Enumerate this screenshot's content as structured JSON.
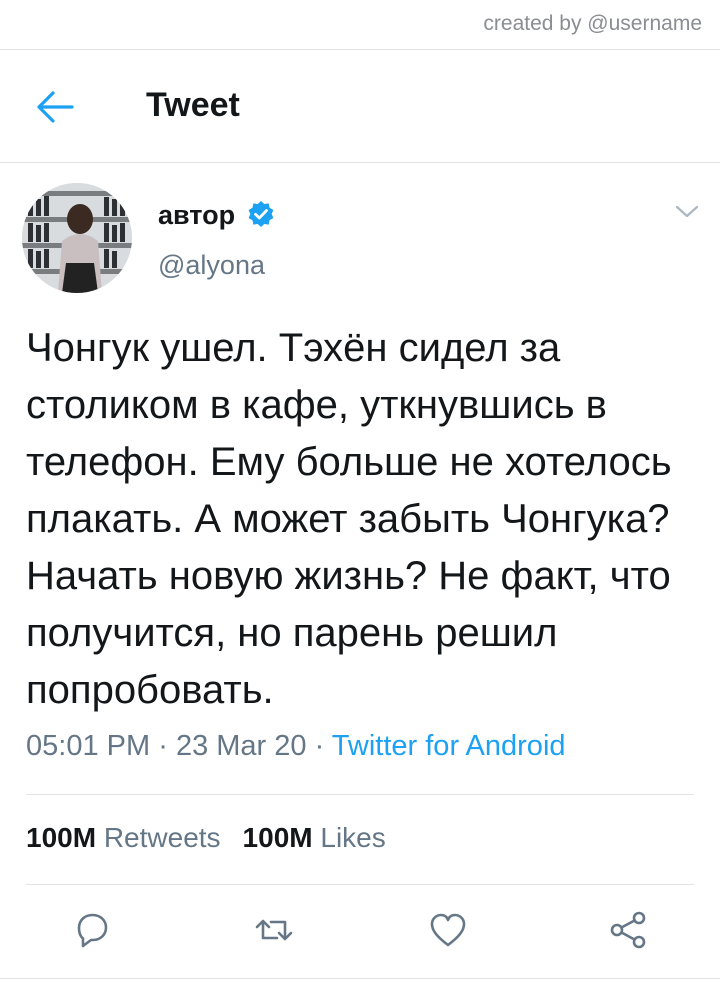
{
  "credit": "created by @username",
  "header": {
    "back_icon": "arrow-left-icon",
    "title": "Tweet"
  },
  "author": {
    "name": "автор",
    "handle": "@alyona",
    "verified_icon": "verified-badge-icon",
    "menu_icon": "chevron-down-icon"
  },
  "tweet": {
    "text": "Чонгук ушел. Тэхён сидел за столиком в кафе, уткнувшись в телефон. Ему больше не хотелось плакать. А может забыть Чонгука? Начать новую жизнь? Не факт, что получится, но парень решил попробовать.",
    "time": "05:01 PM",
    "date": "23 Mar 20",
    "separator": "·",
    "source": "Twitter for Android"
  },
  "stats": {
    "retweets_count": "100M",
    "retweets_label": "Retweets",
    "likes_count": "100M",
    "likes_label": "Likes"
  },
  "actions": [
    "reply-icon",
    "retweet-icon",
    "like-icon",
    "share-icon"
  ],
  "colors": {
    "accent": "#1da1f2",
    "text": "#14171a",
    "secondary": "#657786",
    "divider": "#e1e4e6"
  }
}
